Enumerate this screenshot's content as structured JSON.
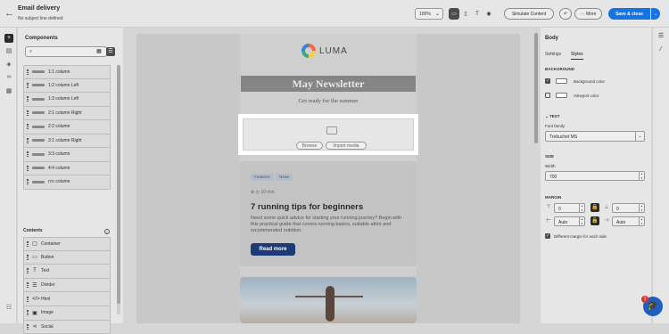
{
  "header": {
    "title": "Email delivery",
    "subtitle": "No subject line defined",
    "zoom": "100%",
    "simulate_label": "Simulate Content",
    "more_label": "More",
    "save_label": "Save & close"
  },
  "components": {
    "title": "Components",
    "search_placeholder": "",
    "items": [
      "1:1 column",
      "1:2 column Left",
      "1:3 column Left",
      "2:1 column Right",
      "2:2 column",
      "3:1 column Right",
      "3:3 column",
      "4:4 column",
      "n:n column"
    ]
  },
  "contents": {
    "title": "Contents",
    "items": [
      {
        "label": "Container",
        "icon": "▢"
      },
      {
        "label": "Button",
        "icon": "▭"
      },
      {
        "label": "Text",
        "icon": "T"
      },
      {
        "label": "Divider",
        "icon": "☰"
      },
      {
        "label": "Html",
        "icon": "</>"
      },
      {
        "label": "Image",
        "icon": "▣"
      },
      {
        "label": "Social",
        "icon": "⋖"
      }
    ]
  },
  "email": {
    "brand": "LUMA",
    "banner": "May Newsletter",
    "tagline": "Get ready for the summer",
    "browse": "Browse",
    "import": "Import media",
    "chips": [
      "Features",
      "News"
    ],
    "meta": "10 min",
    "headline": "7 running tips for beginners",
    "body": "Need some quick advice for starting your running journey? Begin with this practical guide that covers running basics, suitable attire and recommended nutrition.",
    "cta": "Read more"
  },
  "props": {
    "title": "Body",
    "tabs": [
      "Settings",
      "Styles"
    ],
    "background": "BACKGROUND",
    "bg_color": "Background color",
    "viewport_color": "Viewport color",
    "text": "TEXT",
    "font_family_label": "Font family",
    "font_family": "Trebuchet MS",
    "size": "SIZE",
    "width_label": "Width",
    "width": "700",
    "margin": "MARGIN",
    "m_top": "0",
    "m_right": "0",
    "m_left": "Auto",
    "m_right2": "Auto",
    "diff_margin": "Different margin for each side"
  },
  "help_badge": "1"
}
